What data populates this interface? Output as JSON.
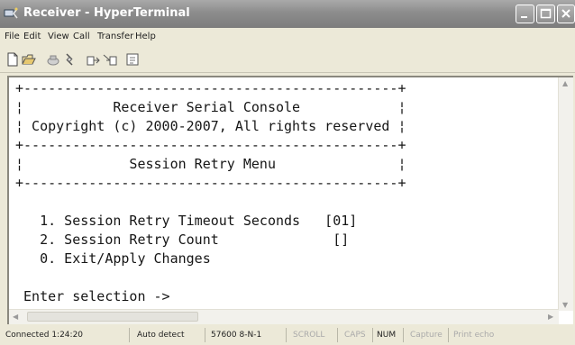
{
  "window": {
    "title": "Receiver - HyperTerminal"
  },
  "menu": [
    "File",
    "Edit",
    "View",
    "Call",
    "Transfer",
    "Help"
  ],
  "toolbar": [
    "new-icon",
    "open-icon",
    "connect-icon",
    "disconnect-icon",
    "send-icon",
    "receive-icon",
    "properties-icon"
  ],
  "terminal": {
    "lines": [
      "+----------------------------------------------+",
      "¦           Receiver Serial Console            ¦",
      "¦ Copyright (c) 2000-2007, All rights reserved ¦",
      "+----------------------------------------------+",
      "¦             Session Retry Menu               ¦",
      "+----------------------------------------------+",
      "",
      "   1. Session Retry Timeout Seconds   [01]",
      "   2. Session Retry Count              []",
      "   0. Exit/Apply Changes",
      "",
      " Enter selection ->"
    ]
  },
  "status": {
    "connected": "Connected 1:24:20",
    "detect": "Auto detect",
    "port": "57600 8-N-1",
    "scroll": "SCROLL",
    "caps": "CAPS",
    "num": "NUM",
    "capture": "Capture",
    "echo": "Print echo"
  }
}
